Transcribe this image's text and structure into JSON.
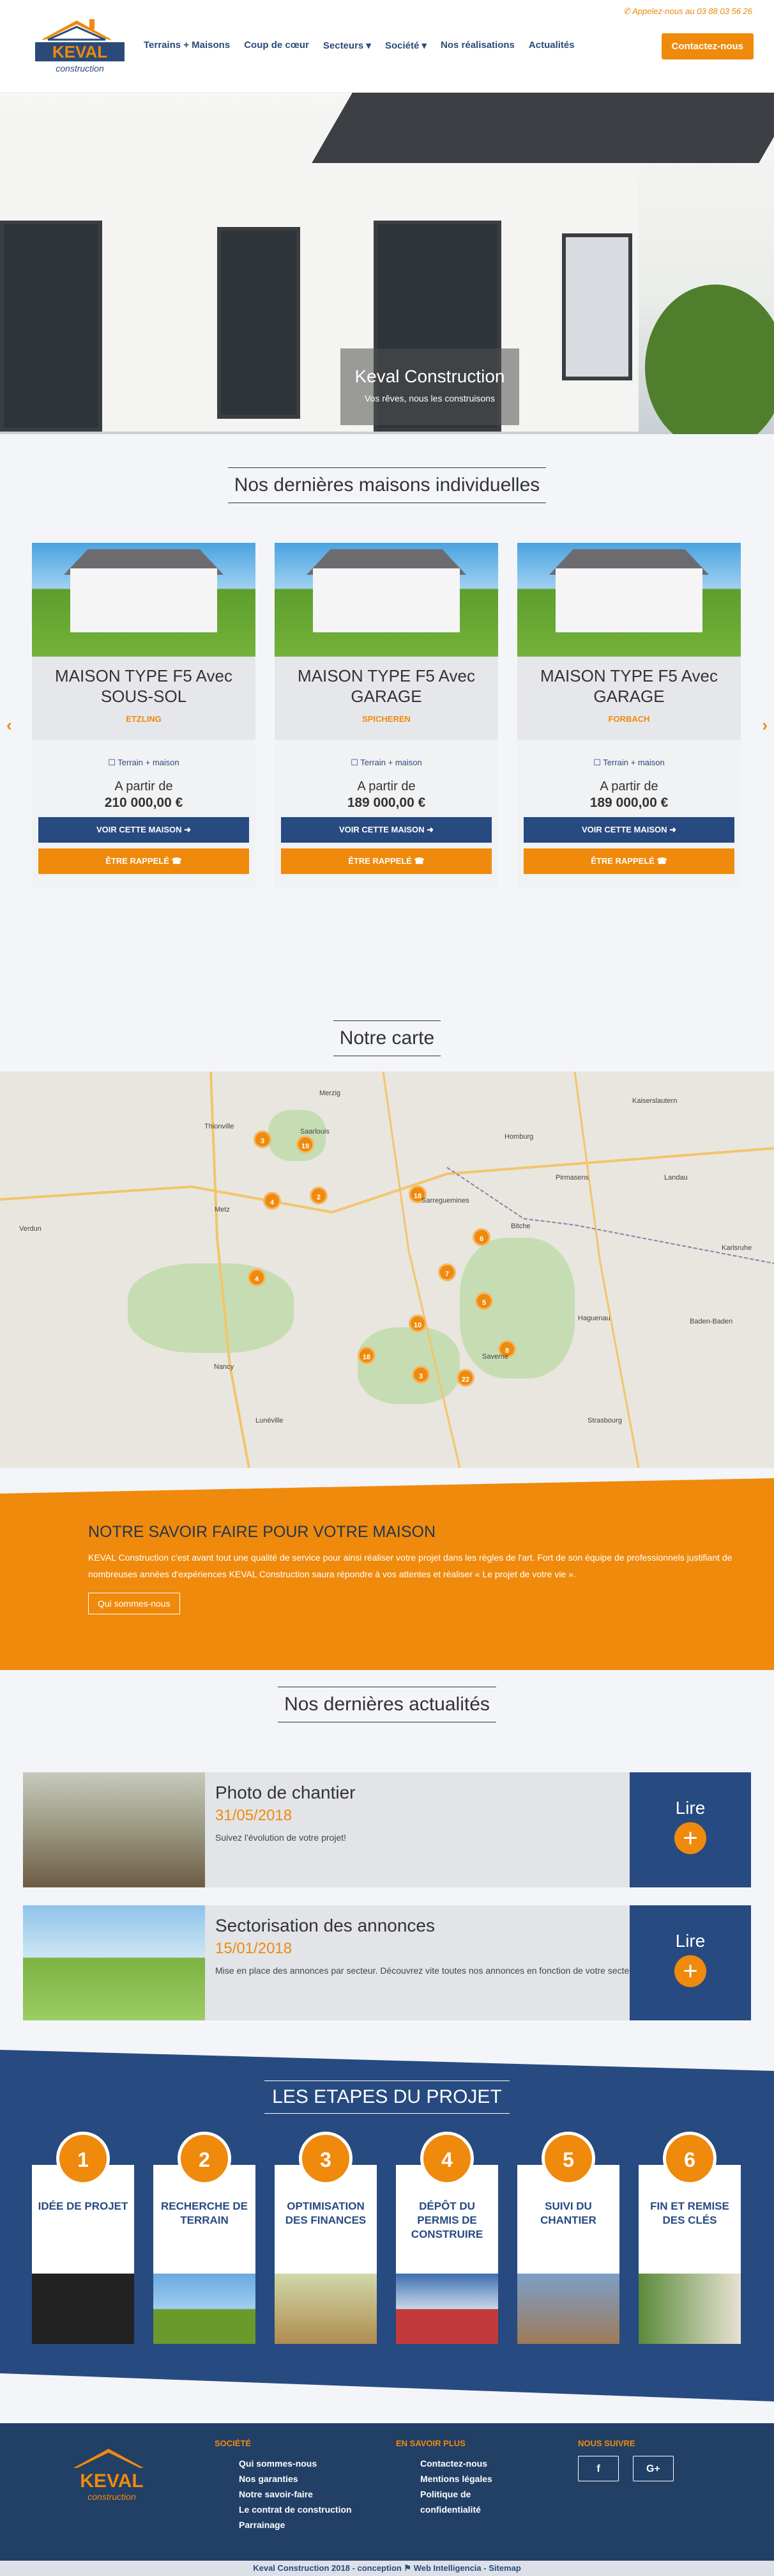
{
  "topbar": {
    "phone": "Appelez-nous au 03 88 03 56 26"
  },
  "brand": {
    "name": "KEVAL",
    "tagline": "construction"
  },
  "nav": {
    "items": [
      "Terrains + Maisons",
      "Coup de cœur",
      "Secteurs ▾",
      "Société ▾",
      "Nos réalisations",
      "Actualités"
    ],
    "cta": "Contactez-nous"
  },
  "hero": {
    "title": "Keval Construction",
    "subtitle": "Vos rêves, nous les construisons"
  },
  "houses": {
    "title": "Nos dernières maisons individuelles",
    "items": [
      {
        "name": "MAISON TYPE F5 Avec SOUS-SOL",
        "city": "ETZLING",
        "tag": "☐ Terrain + maison",
        "from": "A partir de",
        "price": "210 000,00 €",
        "btn_view": "VOIR CETTE MAISON ➜",
        "btn_call": "ÊTRE RAPPELÉ ☎"
      },
      {
        "name": "MAISON TYPE F5 Avec GARAGE",
        "city": "SPICHEREN",
        "tag": "☐ Terrain + maison",
        "from": "A partir de",
        "price": "189 000,00 €",
        "btn_view": "VOIR CETTE MAISON ➜",
        "btn_call": "ÊTRE RAPPELÉ ☎"
      },
      {
        "name": "MAISON TYPE F5 Avec GARAGE",
        "city": "FORBACH",
        "tag": "☐ Terrain + maison",
        "from": "A partir de",
        "price": "189 000,00 €",
        "btn_view": "VOIR CETTE MAISON ➜",
        "btn_call": "ÊTRE RAPPELÉ ☎"
      }
    ]
  },
  "map": {
    "title": "Notre carte",
    "markers": [
      "3",
      "19",
      "2",
      "4",
      "18",
      "6",
      "4",
      "5",
      "10",
      "7",
      "3",
      "22",
      "8",
      "18"
    ],
    "towns": [
      "Thionville",
      "Merzig",
      "Saarlouis",
      "Homburg",
      "Kaiserslautern",
      "Metz",
      "Sarreguemines",
      "Pirmasens",
      "Landau",
      "Verdun",
      "Bitche",
      "Karlsruhe",
      "Nancy",
      "Lunéville",
      "Strasbourg",
      "Baden-Baden",
      "Haguenau",
      "Saverne"
    ]
  },
  "savoir": {
    "title": "NOTRE SAVOIR FAIRE POUR VOTRE MAISON",
    "text": "KEVAL Construction c'est avant tout une qualité de service pour ainsi réaliser votre projet dans les règles de l'art. Fort de son équipe de professionnels justifiant de nombreuses années d'expériences KEVAL Construction saura répondre à vos attentes et réaliser « Le projet de votre vie ».",
    "button": "Qui sommes-nous"
  },
  "news": {
    "title": "Nos dernières actualités",
    "items": [
      {
        "title": "Photo de chantier",
        "date": "31/05/2018",
        "desc": "Suivez l'évolution de votre projet!",
        "lire": "Lire"
      },
      {
        "title": "Sectorisation des annonces",
        "date": "15/01/2018",
        "desc": "Mise en place des annonces par secteur. Découvrez vite toutes nos annonces en fonction de votre secteur",
        "lire": "Lire"
      }
    ]
  },
  "etapes": {
    "title": "LES ETAPES DU PROJET",
    "steps": [
      {
        "num": "1",
        "label": "IDÉE DE PROJET"
      },
      {
        "num": "2",
        "label": "RECHERCHE DE TERRAIN"
      },
      {
        "num": "3",
        "label": "OPTIMISATION DES FINANCES"
      },
      {
        "num": "4",
        "label": "DÉPÔT DU PERMIS DE CONSTRUIRE"
      },
      {
        "num": "5",
        "label": "SUIVI DU CHANTIER"
      },
      {
        "num": "6",
        "label": "FIN ET REMISE DES CLÉS"
      }
    ]
  },
  "footer": {
    "societe": {
      "title": "SOCIÉTÉ",
      "links": [
        "Qui sommes-nous",
        "Nos garanties",
        "Notre savoir-faire",
        "Le contrat de construction",
        "Parrainage"
      ]
    },
    "savoir": {
      "title": "EN SAVOIR PLUS",
      "links": [
        "Contactez-nous",
        "Mentions légales",
        "Politique de confidentialité"
      ]
    },
    "suivre": {
      "title": "NOUS SUIVRE",
      "fb": "f",
      "gp": "G+"
    },
    "bottom": "Keval Construction 2018 - conception ⚑ Web Intelligencia - Sitemap"
  }
}
